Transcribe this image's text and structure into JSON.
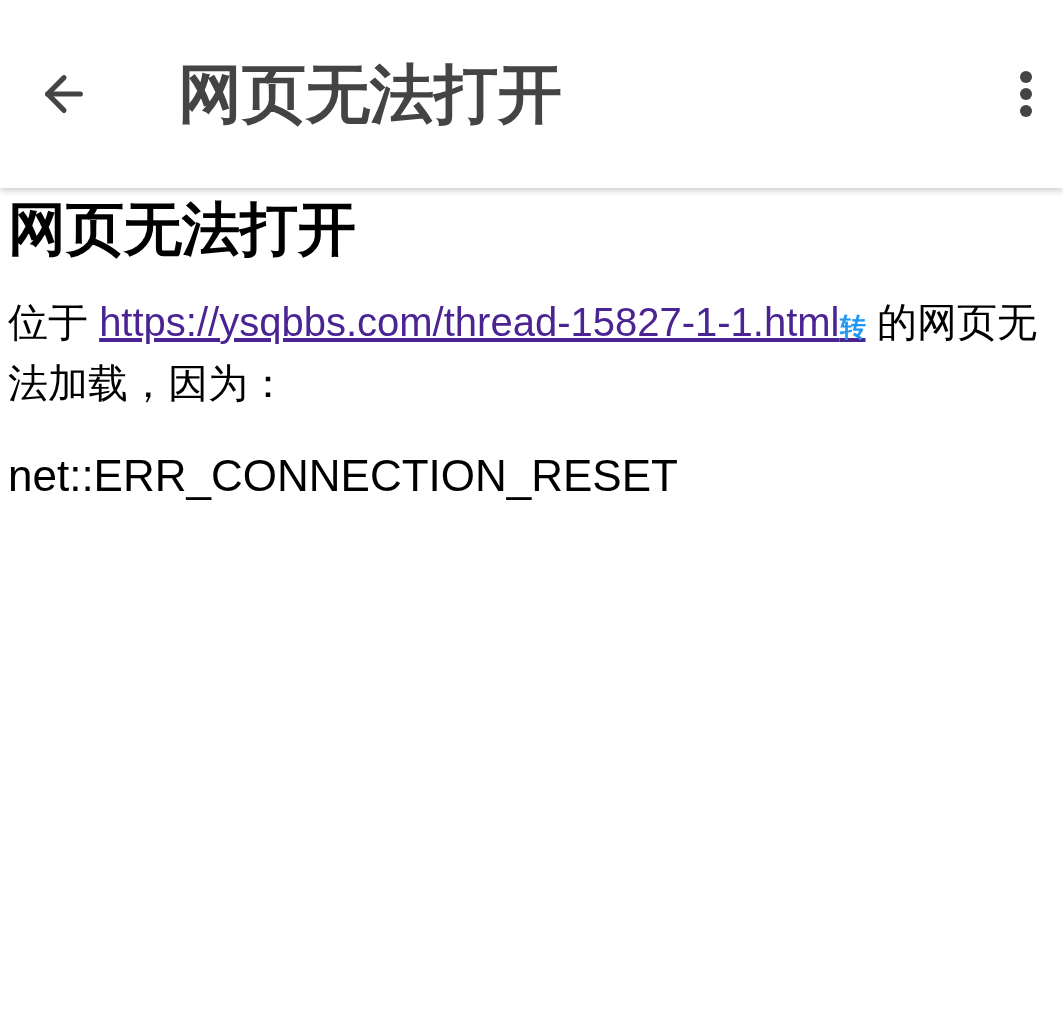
{
  "app_bar": {
    "title": "网页无法打开"
  },
  "heading": "网页无法打开",
  "message": {
    "prefix": "位于 ",
    "link": "https://ysqbbs.com/thread-15827-1-1.html",
    "link_badge": "转",
    "suffix": " 的网页无法加载，因为："
  },
  "error_code": "net::ERR_CONNECTION_RESET"
}
